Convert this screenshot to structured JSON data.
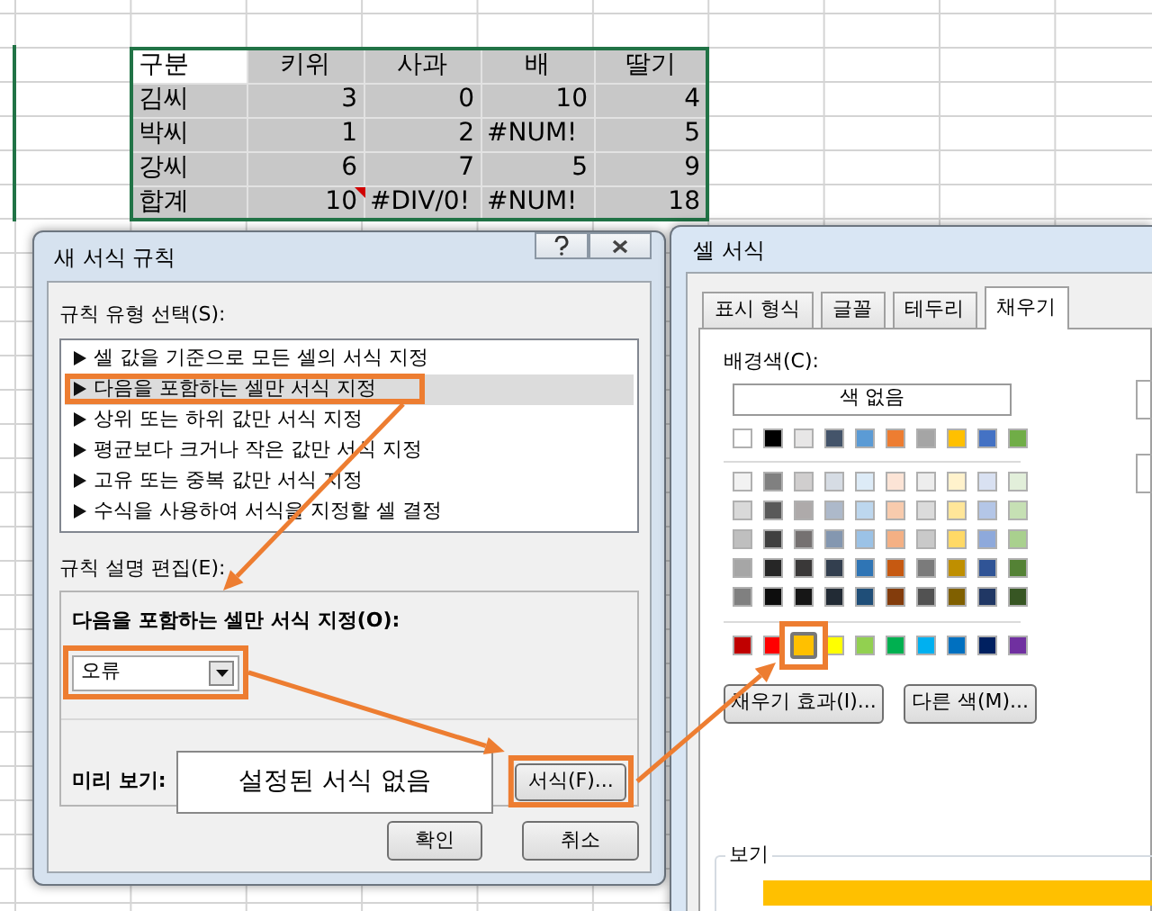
{
  "spreadsheet": {
    "header": [
      {
        "text": "구분",
        "selected": true
      },
      {
        "text": "키위",
        "selected": false
      },
      {
        "text": "사과",
        "selected": false
      },
      {
        "text": "배",
        "selected": false
      },
      {
        "text": "딸기",
        "selected": false
      }
    ],
    "rows": [
      {
        "label": "김씨",
        "cells": [
          {
            "text": "3",
            "kind": "number"
          },
          {
            "text": "0",
            "kind": "number"
          },
          {
            "text": "10",
            "kind": "number"
          },
          {
            "text": "4",
            "kind": "number"
          }
        ]
      },
      {
        "label": "박씨",
        "cells": [
          {
            "text": "1",
            "kind": "number"
          },
          {
            "text": "2",
            "kind": "number"
          },
          {
            "text": "#NUM!",
            "kind": "error"
          },
          {
            "text": "5",
            "kind": "number"
          }
        ]
      },
      {
        "label": "강씨",
        "cells": [
          {
            "text": "6",
            "kind": "number"
          },
          {
            "text": "7",
            "kind": "number"
          },
          {
            "text": "5",
            "kind": "number"
          },
          {
            "text": "9",
            "kind": "number"
          }
        ]
      },
      {
        "label": "합계",
        "cells": [
          {
            "text": "10",
            "kind": "number",
            "note_mark": true
          },
          {
            "text": "#DIV/0!",
            "kind": "error"
          },
          {
            "text": "#NUM!",
            "kind": "error"
          },
          {
            "text": "18",
            "kind": "number"
          }
        ]
      }
    ]
  },
  "rule_dialog": {
    "title": "새 서식 규칙",
    "rule_type_label": "규칙 유형 선택(S):",
    "rule_types": [
      {
        "text": "셀 값을 기준으로 모든 셀의 서식 지정",
        "selected": false
      },
      {
        "text": "다음을 포함하는 셀만 서식 지정",
        "selected": true
      },
      {
        "text": "상위 또는 하위 값만 서식 지정",
        "selected": false
      },
      {
        "text": "평균보다 크거나 작은 값만 서식 지정",
        "selected": false
      },
      {
        "text": "고유 또는 중복 값만 서식 지정",
        "selected": false
      },
      {
        "text": "수식을 사용하여 서식을 지정할 셀 결정",
        "selected": false
      }
    ],
    "edit_label": "규칙 설명 편집(E):",
    "condition_label": "다음을 포함하는 셀만 서식 지정(O):",
    "condition_value": "오류",
    "preview_label": "미리 보기:",
    "preview_text": "설정된 서식 없음",
    "format_button": "서식(F)...",
    "ok_button": "확인",
    "cancel_button": "취소"
  },
  "format_dialog": {
    "title": "셀 서식",
    "tabs": [
      {
        "label": "표시 형식",
        "selected": false
      },
      {
        "label": "글꼴",
        "selected": false
      },
      {
        "label": "테두리",
        "selected": false
      },
      {
        "label": "채우기",
        "selected": true
      }
    ],
    "background_label": "배경색(C):",
    "no_color_button": "색 없음",
    "theme_colors": [
      [
        {
          "color": "#ffffff",
          "selected": false
        },
        {
          "color": "#000000",
          "selected": false
        },
        {
          "color": "#e7e6e6",
          "selected": false
        },
        {
          "color": "#44546a",
          "selected": false
        },
        {
          "color": "#5b9bd5",
          "selected": false
        },
        {
          "color": "#ed7d31",
          "selected": false
        },
        {
          "color": "#a5a5a5",
          "selected": false
        },
        {
          "color": "#ffc000",
          "selected": false
        },
        {
          "color": "#4472c4",
          "selected": false
        },
        {
          "color": "#70ad47",
          "selected": false
        }
      ],
      [
        {
          "color": "#f2f2f2",
          "selected": false
        },
        {
          "color": "#808080",
          "selected": false
        },
        {
          "color": "#d0cece",
          "selected": false
        },
        {
          "color": "#d6dce4",
          "selected": false
        },
        {
          "color": "#ddebf7",
          "selected": false
        },
        {
          "color": "#fce4d6",
          "selected": false
        },
        {
          "color": "#ededed",
          "selected": false
        },
        {
          "color": "#fff2cc",
          "selected": false
        },
        {
          "color": "#d9e1f2",
          "selected": false
        },
        {
          "color": "#e2efda",
          "selected": false
        }
      ],
      [
        {
          "color": "#d9d9d9",
          "selected": false
        },
        {
          "color": "#595959",
          "selected": false
        },
        {
          "color": "#aeaaaa",
          "selected": false
        },
        {
          "color": "#adb9ca",
          "selected": false
        },
        {
          "color": "#bdd7ee",
          "selected": false
        },
        {
          "color": "#f8cbad",
          "selected": false
        },
        {
          "color": "#dbdbdb",
          "selected": false
        },
        {
          "color": "#ffe699",
          "selected": false
        },
        {
          "color": "#b4c6e7",
          "selected": false
        },
        {
          "color": "#c6e0b4",
          "selected": false
        }
      ],
      [
        {
          "color": "#bfbfbf",
          "selected": false
        },
        {
          "color": "#404040",
          "selected": false
        },
        {
          "color": "#757171",
          "selected": false
        },
        {
          "color": "#8497b0",
          "selected": false
        },
        {
          "color": "#9bc2e6",
          "selected": false
        },
        {
          "color": "#f4b084",
          "selected": false
        },
        {
          "color": "#c9c9c9",
          "selected": false
        },
        {
          "color": "#ffd966",
          "selected": false
        },
        {
          "color": "#8ea9db",
          "selected": false
        },
        {
          "color": "#a9d08e",
          "selected": false
        }
      ],
      [
        {
          "color": "#a6a6a6",
          "selected": false
        },
        {
          "color": "#262626",
          "selected": false
        },
        {
          "color": "#3a3838",
          "selected": false
        },
        {
          "color": "#333f4f",
          "selected": false
        },
        {
          "color": "#2f75b5",
          "selected": false
        },
        {
          "color": "#c65911",
          "selected": false
        },
        {
          "color": "#7b7b7b",
          "selected": false
        },
        {
          "color": "#bf8f00",
          "selected": false
        },
        {
          "color": "#305496",
          "selected": false
        },
        {
          "color": "#548235",
          "selected": false
        }
      ],
      [
        {
          "color": "#808080",
          "selected": false
        },
        {
          "color": "#0d0d0d",
          "selected": false
        },
        {
          "color": "#161616",
          "selected": false
        },
        {
          "color": "#222b35",
          "selected": false
        },
        {
          "color": "#1f4e78",
          "selected": false
        },
        {
          "color": "#833c0c",
          "selected": false
        },
        {
          "color": "#525252",
          "selected": false
        },
        {
          "color": "#806000",
          "selected": false
        },
        {
          "color": "#203764",
          "selected": false
        },
        {
          "color": "#375623",
          "selected": false
        }
      ]
    ],
    "standard_colors": [
      {
        "color": "#c00000",
        "selected": false
      },
      {
        "color": "#ff0000",
        "selected": false
      },
      {
        "color": "#ffc000",
        "selected": true
      },
      {
        "color": "#ffff00",
        "selected": false
      },
      {
        "color": "#92d050",
        "selected": false
      },
      {
        "color": "#00b050",
        "selected": false
      },
      {
        "color": "#00b0f0",
        "selected": false
      },
      {
        "color": "#0070c0",
        "selected": false
      },
      {
        "color": "#002060",
        "selected": false
      },
      {
        "color": "#7030a0",
        "selected": false
      }
    ],
    "fill_effects_button": "채우기 효과(I)...",
    "more_colors_button": "다른 색(M)...",
    "sample_label": "보기"
  }
}
